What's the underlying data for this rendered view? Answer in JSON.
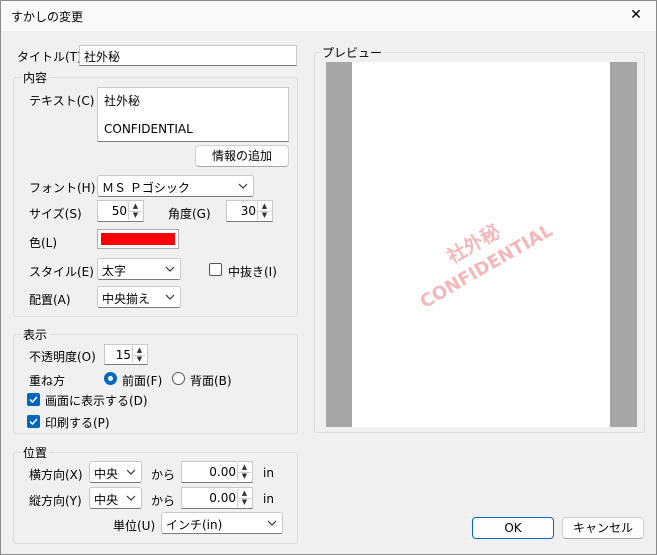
{
  "window": {
    "title": "すかしの変更",
    "close_glyph": "✕"
  },
  "title_field": {
    "label": "タイトル(T)",
    "value": "社外秘"
  },
  "content_group": {
    "title": "内容",
    "text_label": "テキスト(C)",
    "text_line1": "社外秘",
    "text_line2": "CONFIDENTIAL",
    "add_info_button": "情報の追加",
    "font_label": "フォント(H)",
    "font_value": "ＭＳ Ｐゴシック",
    "size_label": "サイズ(S)",
    "size_value": "50",
    "angle_label": "角度(G)",
    "angle_value": "30",
    "color_label": "色(L)",
    "color_swatch": "#ff0000",
    "style_label": "スタイル(E)",
    "style_value": "太字",
    "outline_label": "中抜き(I)",
    "align_label": "配置(A)",
    "align_value": "中央揃え"
  },
  "display_group": {
    "title": "表示",
    "opacity_label": "不透明度(O)",
    "opacity_value": "15",
    "layer_label": "重ね方",
    "front_label": "前面(F)",
    "back_label": "背面(B)",
    "show_screen_label": "画面に表示する(D)",
    "print_label": "印刷する(P)"
  },
  "position_group": {
    "title": "位置",
    "horizontal_label": "横方向(X)",
    "horizontal_value": "中央",
    "vertical_label": "縦方向(Y)",
    "vertical_value": "中央",
    "from_label": "から",
    "h_offset": "0.00",
    "v_offset": "0.00",
    "unit_suffix": "in",
    "unit_label": "単位(U)",
    "unit_value": "インチ(in)"
  },
  "preview": {
    "title": "プレビュー",
    "watermark_line1": "社外秘",
    "watermark_line2": "CONFIDENTIAL",
    "watermark_color": "#f4b8bb"
  },
  "buttons": {
    "ok": "OK",
    "cancel": "キャンセル"
  },
  "colors": {
    "accent": "#0067c0"
  }
}
